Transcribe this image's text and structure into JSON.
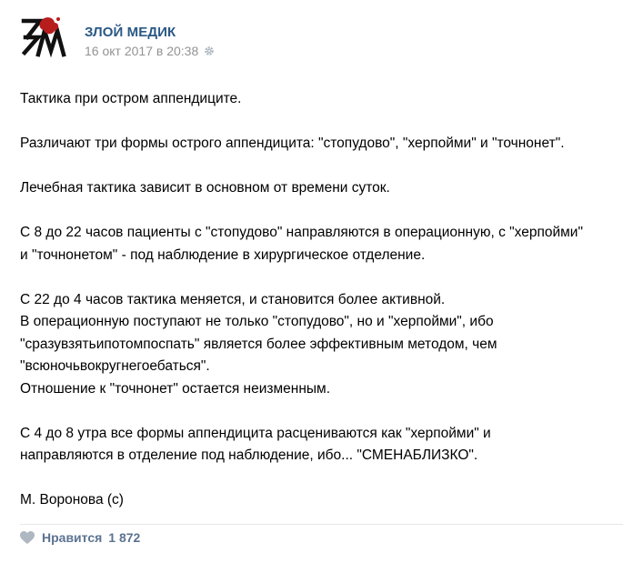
{
  "post": {
    "author": "ЗЛОЙ МЕДИК",
    "avatar_logo_text": "ЗМ",
    "date": "16 окт 2017 в 20:38",
    "lines": [
      "Тактика при остром аппендиците.",
      "",
      "Различают три формы острого аппендицита: \"стопудово\", \"херпойми\" и \"точнонет\".",
      "",
      "Лечебная тактика зависит в основном от времени суток.",
      "",
      "С 8 до 22 часов пациенты с \"стопудово\" направляются в операционную, с \"херпойми\"",
      "и \"точнонетом\" - под наблюдение в хирургическое отделение.",
      "",
      "С 22 до 4 часов тактика меняется, и становится более активной.",
      "В операционную поступают не только \"стопудово\", но и \"херпойми\", ибо",
      "\"сразувзятьипотомпоспать\" является более эффективным методом, чем",
      "\"всюночьвокругнегоебаться\".",
      "Отношение к \"точнонет\" остается неизменным.",
      "",
      "С 4 до 8 утра все формы аппендицита расцениваются как \"херпойми\" и",
      "направляются в отделение под наблюдение, ибо... \"СМЕНАБЛИЗКО\".",
      "",
      "М. Воронова (с)"
    ]
  },
  "footer": {
    "like_label": "Нравится",
    "like_count": "1 872"
  },
  "icons": {
    "settings": "gear-icon",
    "like": "heart-icon"
  },
  "colors": {
    "author_link": "#2a5885",
    "meta_text": "#939393",
    "like_text": "#5b7391",
    "icon_gray": "#aeb7c2",
    "logo_red": "#b81d1d"
  }
}
